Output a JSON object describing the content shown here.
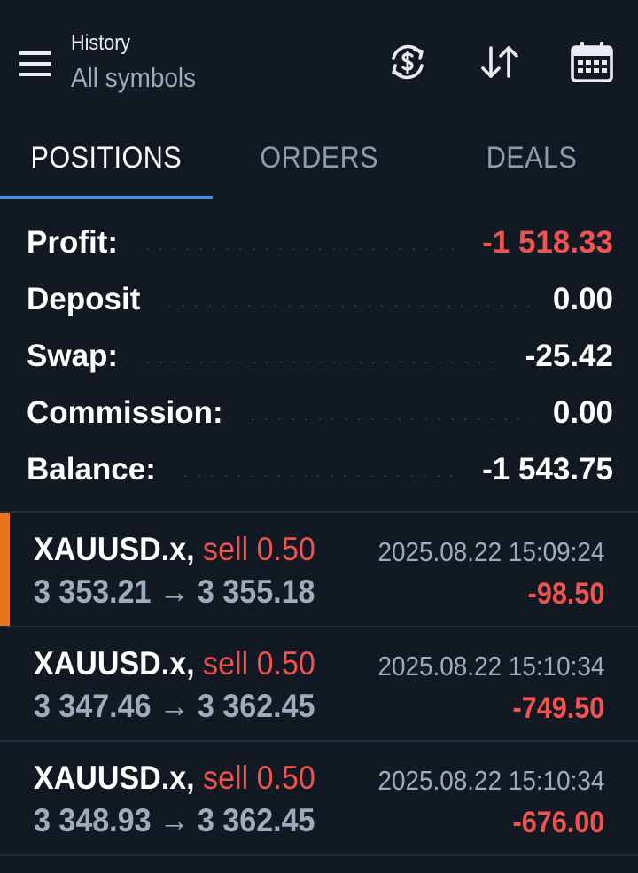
{
  "header": {
    "title": "History",
    "subtitle": "All symbols",
    "icons": [
      "menu-icon",
      "currency-refresh-icon",
      "sort-icon",
      "calendar-icon"
    ]
  },
  "tabs": [
    {
      "label": "POSITIONS",
      "active": true
    },
    {
      "label": "ORDERS",
      "active": false
    },
    {
      "label": "DEALS",
      "active": false
    }
  ],
  "summary": {
    "profit": {
      "label": "Profit:",
      "value": "-1 518.33"
    },
    "deposit": {
      "label": "Deposit",
      "value": "0.00"
    },
    "swap": {
      "label": "Swap:",
      "value": "-25.42"
    },
    "commission": {
      "label": "Commission:",
      "value": "0.00"
    },
    "balance": {
      "label": "Balance:",
      "value": "-1 543.75"
    }
  },
  "positions": [
    {
      "symbol": "XAUUSD.x,",
      "side": "sell 0.50",
      "open_price": "3 353.21",
      "close_price": "3 355.18",
      "time": "2025.08.22 15:09:24",
      "profit": "-98.50"
    },
    {
      "symbol": "XAUUSD.x,",
      "side": "sell 0.50",
      "open_price": "3 347.46",
      "close_price": "3 362.45",
      "time": "2025.08.22 15:10:34",
      "profit": "-749.50"
    },
    {
      "symbol": "XAUUSD.x,",
      "side": "sell 0.50",
      "open_price": "3 348.93",
      "close_price": "3 362.45",
      "time": "2025.08.22 15:10:34",
      "profit": "-676.00"
    }
  ],
  "arrow": "→",
  "colors": {
    "background": "#121922",
    "loss": "#ef5350",
    "muted": "#9eabba",
    "tab_indicator": "#3d8ee8",
    "selected_accent": "#e8741b"
  }
}
